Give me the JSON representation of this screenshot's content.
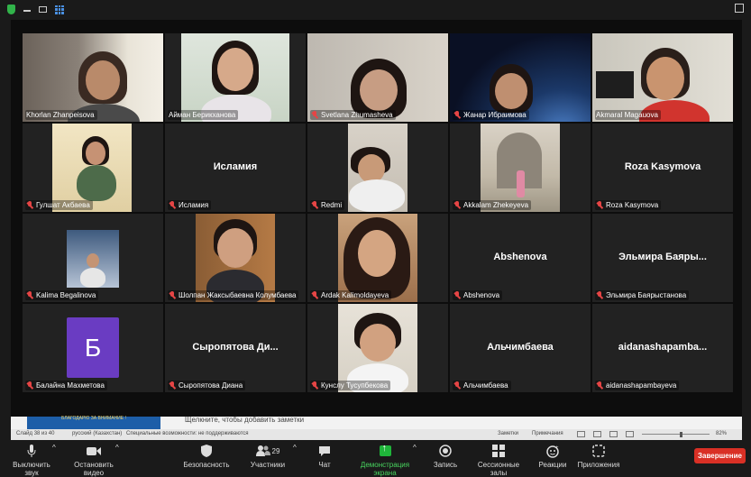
{
  "participants": [
    {
      "name": "Khorlan Zhanpeisova",
      "muted": false,
      "type": "video"
    },
    {
      "name": "Айман Берикханова",
      "muted": false,
      "type": "video"
    },
    {
      "name": "Svetlana Zhumasheva",
      "muted": true,
      "type": "video"
    },
    {
      "name": "Жанар Ибраимова",
      "muted": true,
      "type": "video"
    },
    {
      "name": "Akmaral Magauova",
      "muted": false,
      "type": "video",
      "active": true
    },
    {
      "name": "Гулшат Акбаева",
      "muted": true,
      "type": "video"
    },
    {
      "name": "Исламия",
      "muted": true,
      "type": "name",
      "display": "Исламия"
    },
    {
      "name": "Redmi",
      "muted": true,
      "type": "video"
    },
    {
      "name": "Akkalam Zhekeyeva",
      "muted": true,
      "type": "video"
    },
    {
      "name": "Roza Kasymova",
      "muted": true,
      "type": "name",
      "display": "Roza Kasymova"
    },
    {
      "name": "Kalima Begalinova",
      "muted": true,
      "type": "video"
    },
    {
      "name": "Шолпан Жаксыбаевна Колумбаева",
      "muted": true,
      "type": "video"
    },
    {
      "name": "Ardak Kalimoldayeva",
      "muted": true,
      "type": "video"
    },
    {
      "name": "Abshenova",
      "muted": true,
      "type": "name",
      "display": "Abshenova"
    },
    {
      "name": "Эльмира Баярыстанова",
      "muted": true,
      "type": "name",
      "display": "Эльмира Баяры..."
    },
    {
      "name": "Балайна Махметова",
      "muted": true,
      "type": "avatar",
      "avatar_letter": "Б"
    },
    {
      "name": "Сыропятова Диана",
      "muted": true,
      "type": "name",
      "display": "Сыропятова Ди..."
    },
    {
      "name": "Кунслу Тусупбекова",
      "muted": true,
      "type": "video"
    },
    {
      "name": "Альчимбаева",
      "muted": true,
      "type": "name",
      "display": "Альчимбаева"
    },
    {
      "name": "aidanashapambayeva",
      "muted": true,
      "type": "name",
      "display": "aidanashapamba..."
    }
  ],
  "presentation": {
    "slide_thumb_text": "БЛАГОДАРЮ ЗА ВНИМАНИЕ !",
    "notes_placeholder": "Щелкните, чтобы добавить заметки",
    "status_slide": "Слайд 38 из 40",
    "status_language": "русский (Казахстан)",
    "status_accessibility": "Специальные возможности: не поддерживаются",
    "notes_label": "Заметки",
    "comments_label": "Примечания",
    "zoom": "82%"
  },
  "toolbar": {
    "mute_label": "Выключить звук",
    "video_label": "Остановить видео",
    "security_label": "Безопасность",
    "participants_label": "Участники",
    "participants_count": "29",
    "chat_label": "Чат",
    "share_label": "Демонстрация экрана",
    "record_label": "Запись",
    "breakout_label": "Сессионные залы",
    "reactions_label": "Реакции",
    "apps_label": "Приложения",
    "end_label": "Завершение"
  },
  "colors": {
    "active_speaker": "#a6d14b",
    "muted_icon": "#e54545",
    "end_button": "#d93025",
    "share_green": "#1fb53a",
    "avatar_purple": "#6a3cc2"
  }
}
